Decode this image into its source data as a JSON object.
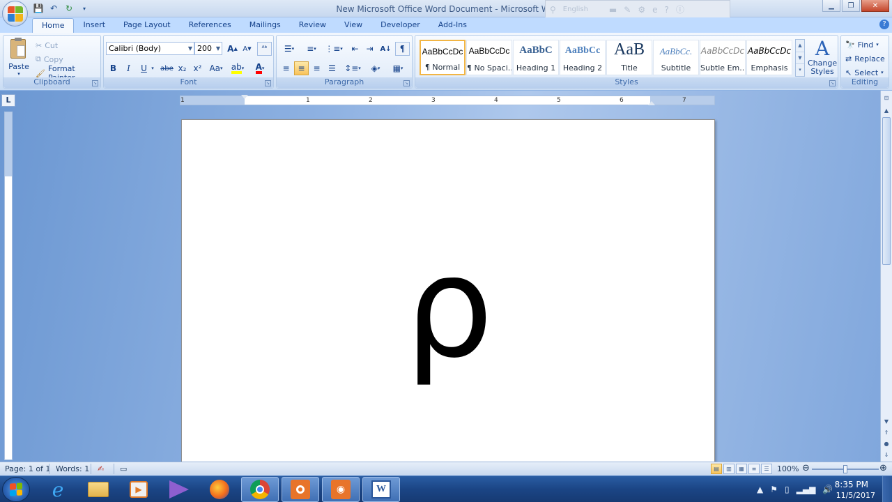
{
  "window": {
    "title": "New Microsoft Office Word Document - Microsoft Word",
    "language": "English"
  },
  "quick_access": {
    "icons": [
      "save-icon",
      "undo-icon",
      "redo-icon",
      "customize-icon"
    ]
  },
  "tabs": [
    "Home",
    "Insert",
    "Page Layout",
    "References",
    "Mailings",
    "Review",
    "View",
    "Developer",
    "Add-Ins"
  ],
  "active_tab": "Home",
  "clipboard": {
    "label": "Clipboard",
    "paste": "Paste",
    "cut": "Cut",
    "copy": "Copy",
    "format_painter": "Format Painter"
  },
  "font": {
    "label": "Font",
    "family": "Calibri (Body)",
    "size": "200",
    "bold": "B",
    "italic": "I",
    "underline": "U",
    "strike": "abe",
    "subscript": "x₂",
    "superscript": "x²",
    "change_case": "Aa",
    "grow": "A",
    "shrink": "A",
    "highlight_color": "#ffff00",
    "font_color": "#ff0000"
  },
  "paragraph": {
    "label": "Paragraph",
    "pilcrow": "¶"
  },
  "styles": {
    "label": "Styles",
    "items": [
      {
        "preview": "AaBbCcDc",
        "name": "¶ Normal"
      },
      {
        "preview": "AaBbCcDc",
        "name": "¶ No Spaci..."
      },
      {
        "preview": "AaBbC",
        "name": "Heading 1"
      },
      {
        "preview": "AaBbCc",
        "name": "Heading 2"
      },
      {
        "preview": "AaB",
        "name": "Title"
      },
      {
        "preview": "AaBbCc.",
        "name": "Subtitle"
      },
      {
        "preview": "AaBbCcDc",
        "name": "Subtle Em..."
      },
      {
        "preview": "AaBbCcDc",
        "name": "Emphasis"
      }
    ],
    "change_styles": "Change Styles"
  },
  "editing": {
    "label": "Editing",
    "find": "Find",
    "replace": "Replace",
    "select": "Select"
  },
  "ruler": {
    "numbers": [
      "1",
      "1",
      "2",
      "3",
      "4",
      "5",
      "6",
      "7"
    ]
  },
  "document": {
    "content": "ρ"
  },
  "status": {
    "page": "Page: 1 of 1",
    "words": "Words: 1",
    "zoom": "100%"
  },
  "taskbar": {
    "apps": [
      "internet-explorer-icon",
      "file-explorer-icon",
      "media-player-icon",
      "visual-studio-icon",
      "firefox-icon",
      "chrome-icon",
      "app-orange-icon",
      "camera-app-icon",
      "word-icon"
    ],
    "time": "8:35 PM",
    "date": "11/5/2017"
  },
  "colors": {
    "accent_blue": "#15428b",
    "ribbon_bg": "#dde9f8",
    "selected_gold": "#f2b544"
  }
}
